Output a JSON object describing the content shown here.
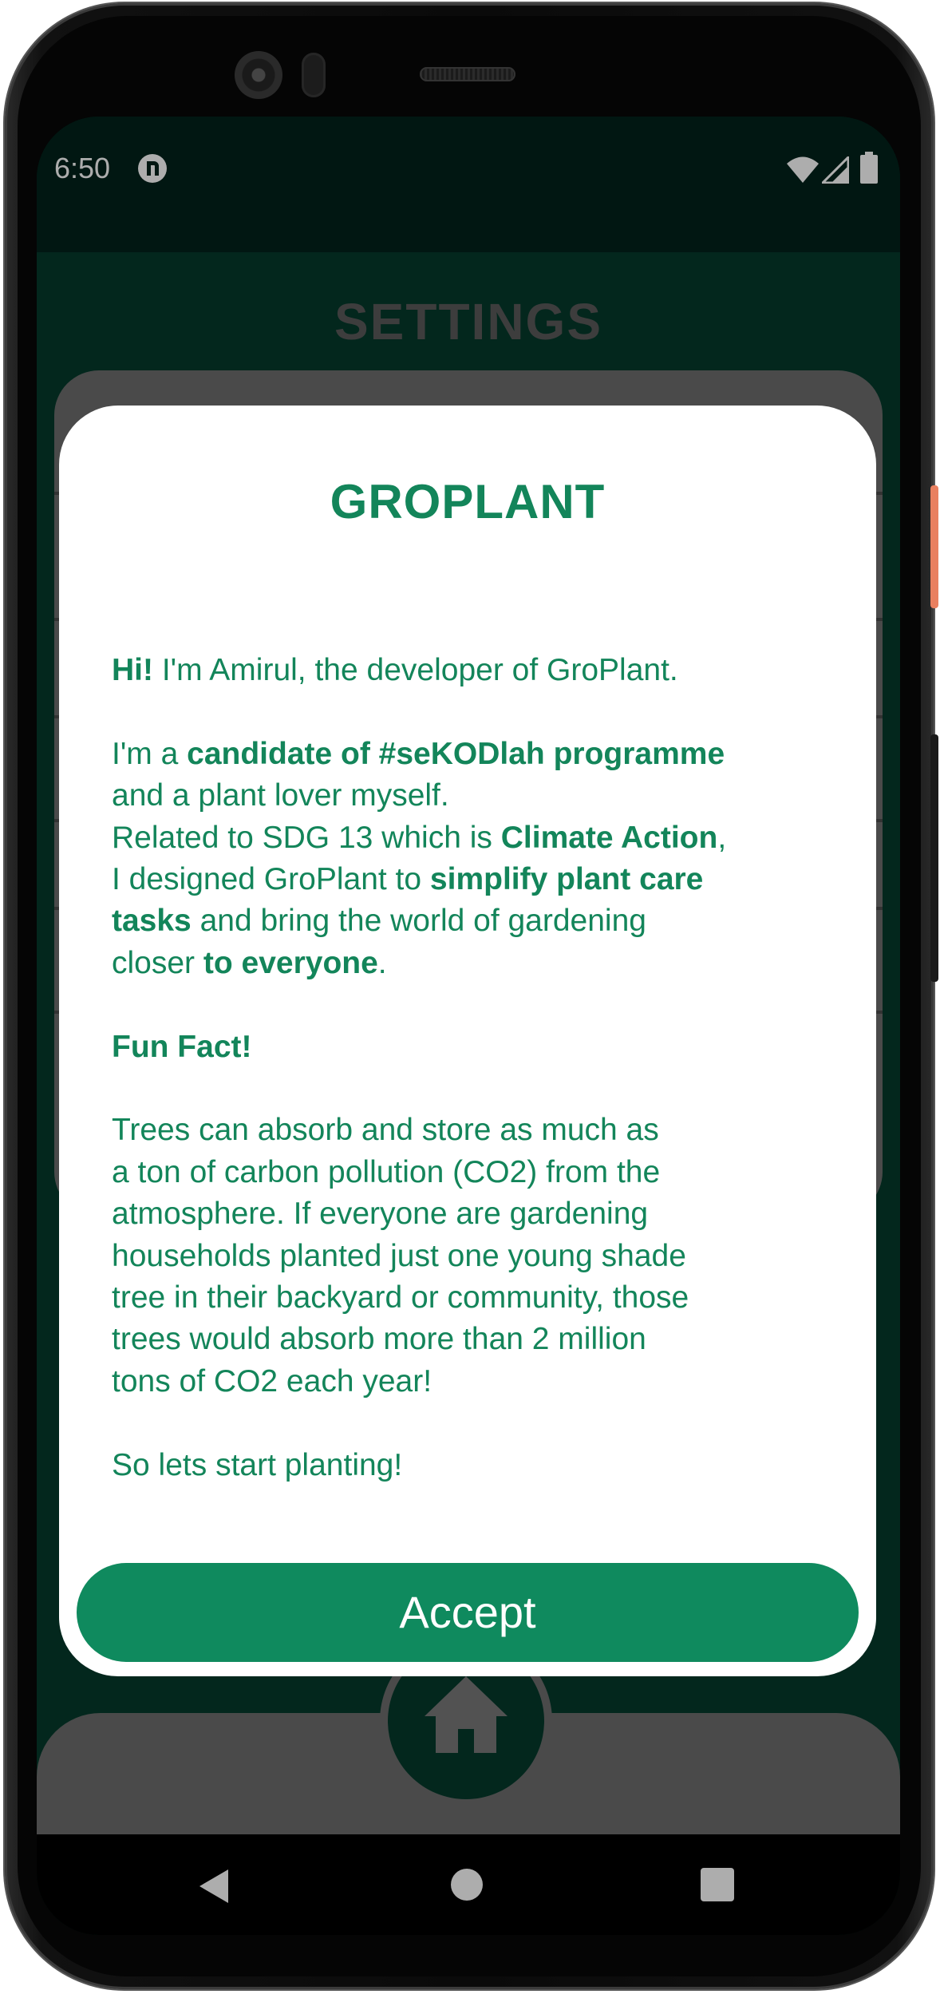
{
  "status_bar": {
    "time": "6:50",
    "icons": [
      "app-notification-icon",
      "wifi-icon",
      "signal-icon",
      "battery-icon"
    ]
  },
  "screen": {
    "title": "SETTINGS"
  },
  "dialog": {
    "title": "GROPLANT",
    "greeting_bold": "Hi!",
    "greeting_rest": " I'm Amirul, the developer of GroPlant.",
    "p2_a": "I'm a ",
    "p2_b": "candidate of #seKODlah programme",
    "p2_c": "and a plant lover myself.",
    "p2_d": "Related to SDG 13 which is ",
    "p2_e": "Climate Action",
    "p2_f": ",",
    "p2_g": "I designed GroPlant to ",
    "p2_h": "simplify plant care",
    "p2_i": "tasks",
    "p2_j": " and bring the world of gardening",
    "p2_k": "closer ",
    "p2_l": "to everyone",
    "p2_m": ".",
    "fun_fact_heading": "Fun Fact!",
    "fun_fact_lines": [
      "Trees can absorb and store as much as",
      "a ton of carbon pollution (CO2) from the",
      "atmosphere. If everyone are gardening",
      "households planted just one young shade",
      "tree in their backyard or community, those",
      "trees would absorb more than 2 million",
      "tons of CO2 each year!"
    ],
    "closing": "So lets start planting!",
    "accept_label": "Accept"
  },
  "bottom_nav": {
    "home_icon": "home-icon"
  },
  "system_nav": {
    "buttons": [
      "back-icon",
      "home-circle-icon",
      "recents-icon"
    ]
  },
  "colors": {
    "brand_green": "#13855a",
    "button_green": "#0f8a5e",
    "app_background": "#053a2c"
  }
}
